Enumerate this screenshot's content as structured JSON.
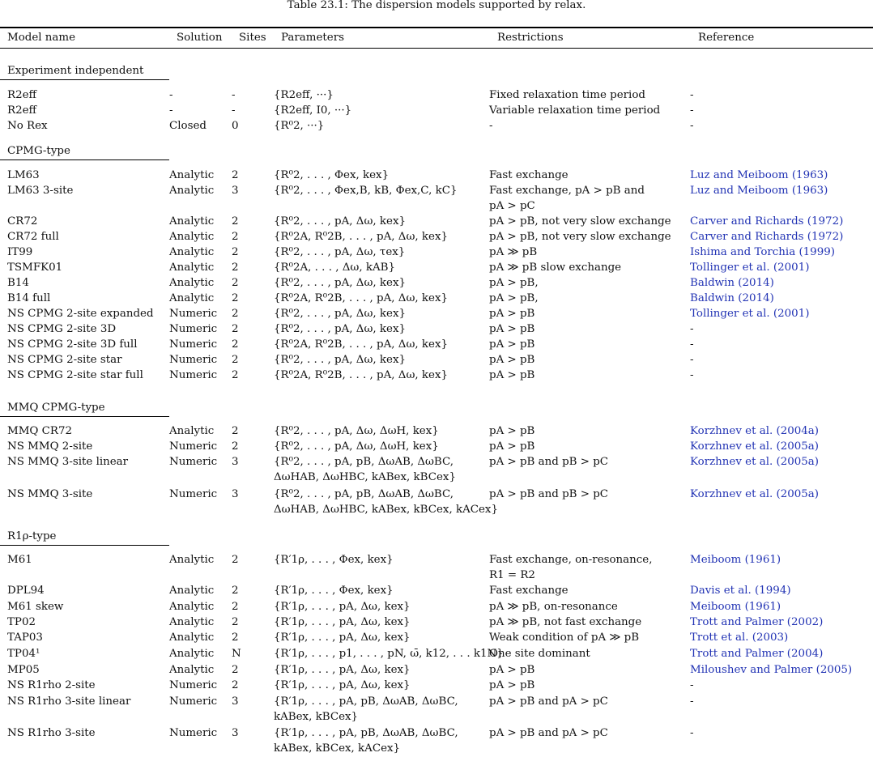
{
  "caption": "Table 23.1: The dispersion models supported by relax.",
  "columns": [
    "Model name",
    "Solution",
    "Sites",
    "Parameters",
    "Restrictions",
    "Reference"
  ],
  "sections": [
    {
      "title": "Experiment independent"
    },
    {
      "title": "CPMG-type"
    },
    {
      "title": "MMQ CPMG-type"
    },
    {
      "title": "R1ρ-type"
    }
  ],
  "rows": [
    [
      "R2eff",
      "-",
      "-",
      "{R2eff, ···}",
      "Fixed relaxation time period",
      "-"
    ],
    [
      "R2eff",
      "-",
      "-",
      "{R2eff, I0, ···}",
      "Variable relaxation time period",
      "-"
    ],
    [
      "No Rex",
      "Closed",
      "0",
      "{R⁰2, ···}",
      "-",
      "-"
    ],
    [
      "LM63",
      "Analytic",
      "2",
      "{R⁰2, . . . , Φex, kex}",
      "Fast exchange",
      "Luz and Meiboom (1963)"
    ],
    [
      "LM63 3-site",
      "Analytic",
      "3",
      "{R⁰2, . . . , Φex,B, kB, Φex,C, kC}",
      "Fast exchange, pA > pB and pA > pC",
      "Luz and Meiboom (1963)"
    ],
    [
      "CR72",
      "Analytic",
      "2",
      "{R⁰2, . . . , pA, Δω, kex}",
      "pA > pB, not very slow exchange",
      "Carver and Richards (1972)"
    ],
    [
      "CR72 full",
      "Analytic",
      "2",
      "{R⁰2A, R⁰2B, . . . , pA, Δω, kex}",
      "pA > pB, not very slow exchange",
      "Carver and Richards (1972)"
    ],
    [
      "IT99",
      "Analytic",
      "2",
      "{R⁰2, . . . , pA, Δω, τex}",
      "pA ≫ pB",
      "Ishima and Torchia (1999)"
    ],
    [
      "TSMFK01",
      "Analytic",
      "2",
      "{R⁰2A, . . . , Δω, kAB}",
      "pA ≫ pB slow exchange",
      "Tollinger et al. (2001)"
    ],
    [
      "B14",
      "Analytic",
      "2",
      "{R⁰2, . . . , pA, Δω, kex}",
      "pA > pB,",
      "Baldwin (2014)"
    ],
    [
      "B14 full",
      "Analytic",
      "2",
      "{R⁰2A, R⁰2B, . . . , pA, Δω, kex}",
      "pA > pB,",
      "Baldwin (2014)"
    ],
    [
      "NS CPMG 2-site expanded",
      "Numeric",
      "2",
      "{R⁰2, . . . , pA, Δω, kex}",
      "pA > pB",
      "Tollinger et al. (2001)"
    ],
    [
      "NS CPMG 2-site 3D",
      "Numeric",
      "2",
      "{R⁰2, . . . , pA, Δω, kex}",
      "pA > pB",
      "-"
    ],
    [
      "NS CPMG 2-site 3D full",
      "Numeric",
      "2",
      "{R⁰2A, R⁰2B, . . . , pA, Δω, kex}",
      "pA > pB",
      "-"
    ],
    [
      "NS CPMG 2-site star",
      "Numeric",
      "2",
      "{R⁰2, . . . , pA, Δω, kex}",
      "pA > pB",
      "-"
    ],
    [
      "NS CPMG 2-site star full",
      "Numeric",
      "2",
      "{R⁰2A, R⁰2B, . . . , pA, Δω, kex}",
      "pA > pB",
      "-"
    ],
    [
      "MMQ CR72",
      "Analytic",
      "2",
      "{R⁰2, . . . , pA, Δω, ΔωH, kex}",
      "pA > pB",
      "Korzhnev et al. (2004a)"
    ],
    [
      "NS MMQ 2-site",
      "Numeric",
      "2",
      "{R⁰2, . . . , pA, Δω, ΔωH, kex}",
      "pA > pB",
      "Korzhnev et al. (2005a)"
    ],
    [
      "NS MMQ 3-site linear",
      "Numeric",
      "3",
      "{R⁰2, . . . , pA, pB, ΔωAB, ΔωBC, ΔωHAB, ΔωHBC, kABex, kBCex}",
      "pA > pB and pB > pC",
      "Korzhnev et al. (2005a)"
    ],
    [
      "NS MMQ 3-site",
      "Numeric",
      "3",
      "{R⁰2, . . . , pA, pB, ΔωAB, ΔωBC, ΔωHAB, ΔωHBC, kABex, kBCex, kACex}",
      "pA > pB and pB > pC",
      "Korzhnev et al. (2005a)"
    ],
    [
      "M61",
      "Analytic",
      "2",
      "{R′1ρ, . . . , Φex, kex}",
      "Fast exchange, on-resonance, R1 = R2",
      "Meiboom (1961)"
    ],
    [
      "DPL94",
      "Analytic",
      "2",
      "{R′1ρ, . . . , Φex, kex}",
      "Fast exchange",
      "Davis et al. (1994)"
    ],
    [
      "M61 skew",
      "Analytic",
      "2",
      "{R′1ρ, . . . , pA, Δω, kex}",
      "pA ≫ pB, on-resonance",
      "Meiboom (1961)"
    ],
    [
      "TP02",
      "Analytic",
      "2",
      "{R′1ρ, . . . , pA, Δω, kex}",
      "pA ≫ pB, not fast exchange",
      "Trott and Palmer (2002)"
    ],
    [
      "TAP03",
      "Analytic",
      "2",
      "{R′1ρ, . . . , pA, Δω, kex}",
      "Weak condition of pA ≫ pB",
      "Trott et al. (2003)"
    ],
    [
      "TP04¹",
      "Analytic",
      "N",
      "{R′1ρ, . . . , p1, . . . , pN, ω̄, k12, . . . k1N}",
      "One site dominant",
      "Trott and Palmer (2004)"
    ],
    [
      "MP05",
      "Analytic",
      "2",
      "{R′1ρ, . . . , pA, Δω, kex}",
      "pA > pB",
      "Miloushev and Palmer (2005)"
    ],
    [
      "NS R1rho 2-site",
      "Numeric",
      "2",
      "{R′1ρ, . . . , pA, Δω, kex}",
      "pA > pB",
      "-"
    ],
    [
      "NS R1rho 3-site linear",
      "Numeric",
      "3",
      "{R′1ρ, . . . , pA, pB, ΔωAB, ΔωBC, kABex, kBCex}",
      "pA > pB and pA > pC",
      "-"
    ],
    [
      "NS R1rho 3-site",
      "Numeric",
      "3",
      "{R′1ρ, . . . , pA, pB, ΔωAB, ΔωBC, kABex, kBCex, kACex}",
      "pA > pB and pA > pC",
      "-"
    ]
  ]
}
